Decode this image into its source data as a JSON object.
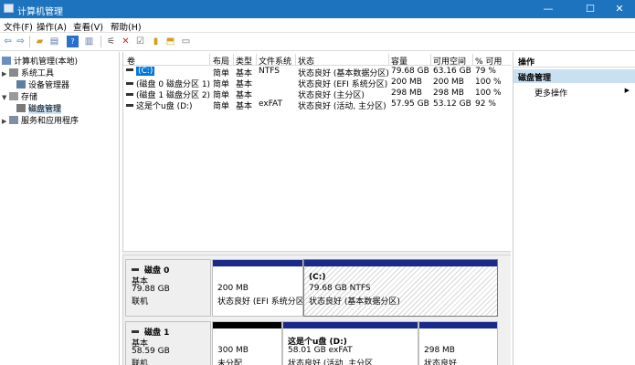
{
  "window": {
    "title": "计算机管理",
    "controls": [
      "—",
      "☐",
      "✕"
    ]
  },
  "menu": [
    "文件(F)",
    "操作(A)",
    "查看(V)",
    "帮助(H)"
  ],
  "toolbar": {
    "icons": [
      "back-arrow-icon",
      "forward-arrow-icon",
      "folder-up-icon",
      "show-hide-tree-icon",
      "help-icon",
      "show-hide-action-pane-icon",
      "connect-icon",
      "delete-icon",
      "properties-icon",
      "open-icon",
      "rescan-icon",
      "list-view-icon"
    ]
  },
  "tree": [
    {
      "label": "计算机管理(本地)",
      "expander": "",
      "level": 0
    },
    {
      "label": "系统工具",
      "expander": "▶",
      "level": 1
    },
    {
      "label": "设备管理器",
      "expander": "",
      "level": 2
    },
    {
      "label": "存储",
      "expander": "▼",
      "level": 1
    },
    {
      "label": "磁盘管理",
      "expander": "",
      "level": 2,
      "selected": true
    },
    {
      "label": "服务和应用程序",
      "expander": "▶",
      "level": 1
    }
  ],
  "volumes": {
    "columns": [
      "卷",
      "布局",
      "类型",
      "文件系统",
      "状态",
      "容量",
      "可用空间",
      "% 可用"
    ],
    "rows": [
      [
        "(C:)",
        "简单",
        "基本",
        "NTFS",
        "状态良好 (基本数据分区)",
        "79.68 GB",
        "63.16 GB",
        "79 %"
      ],
      [
        "(磁盘 0 磁盘分区 1)",
        "简单",
        "基本",
        "",
        "状态良好 (EFI 系统分区)",
        "200 MB",
        "200 MB",
        "100 %"
      ],
      [
        "(磁盘 1 磁盘分区 2)",
        "简单",
        "基本",
        "",
        "状态良好 (主分区)",
        "298 MB",
        "298 MB",
        "100 %"
      ],
      [
        "这是个u盘 (D:)",
        "简单",
        "基本",
        "exFAT",
        "状态良好 (活动, 主分区)",
        "57.95 GB",
        "53.12 GB",
        "92 %"
      ]
    ]
  },
  "disks": [
    {
      "name": "磁盘 0",
      "type": "基本",
      "size": "79.88 GB",
      "status": "联机",
      "partitions": [
        {
          "title": "",
          "size": "200 MB",
          "status": "状态良好 (EFI 系统分区",
          "bar_color": "#1a2a8a"
        },
        {
          "title": "(C:)",
          "size": "79.68 GB NTFS",
          "status": "状态良好 (基本数据分区)",
          "bar_color": "#1a2a8a"
        }
      ]
    },
    {
      "name": "磁盘 1",
      "type": "基本",
      "size": "58.59 GB",
      "status": "联机",
      "partitions": [
        {
          "title": "",
          "size": "300 MB",
          "status": "未分配",
          "bar_color": "#000000"
        },
        {
          "title": "这是个u盘 (D:)",
          "size": "58.01 GB exFAT",
          "status": "状态良好 (活动, 主分区",
          "bar_color": "#1a2a8a"
        },
        {
          "title": "",
          "size": "298 MB",
          "status": "状态良好",
          "bar_color": "#1a2a8a"
        }
      ]
    }
  ],
  "actions": {
    "header": "操作",
    "section": "磁盘管理",
    "more": "更多操作",
    "more_arrow": "▶"
  },
  "colors": {
    "titlebar": "#1e73be",
    "selection": "#0078d7",
    "partition_bar": "#1a2a8a",
    "unallocated_bar": "#000000",
    "action_section_bg": "#c9dff2"
  }
}
